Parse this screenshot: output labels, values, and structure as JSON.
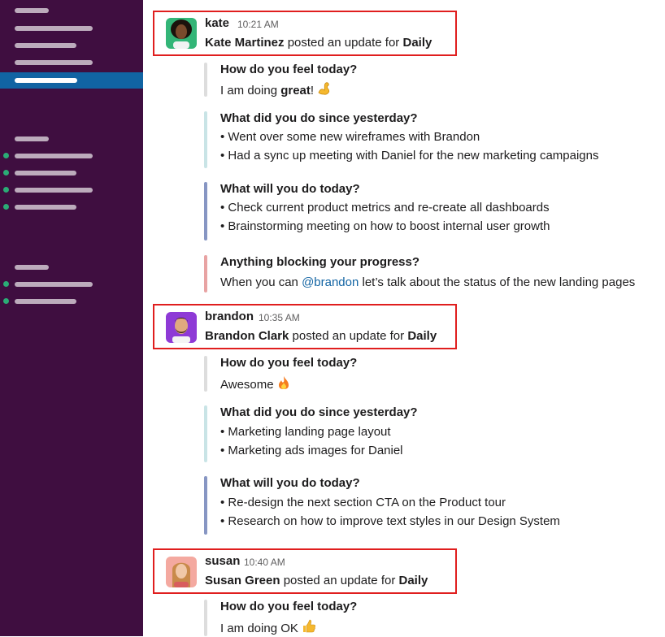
{
  "sidebar": {
    "items": [
      {
        "kind": "bar"
      },
      {
        "kind": "bar"
      },
      {
        "kind": "bar"
      },
      {
        "kind": "active"
      },
      {
        "kind": "header"
      },
      {
        "kind": "dm"
      },
      {
        "kind": "dm"
      },
      {
        "kind": "dm"
      },
      {
        "kind": "dm"
      },
      {
        "kind": "header"
      },
      {
        "kind": "dm"
      },
      {
        "kind": "dm"
      }
    ]
  },
  "colors": {
    "sidebar_bg": "#3f0e40",
    "active_row": "#1164a3",
    "presence": "#2bac76",
    "highlight_box": "#e01e1e",
    "bar_q1": "#dddddd",
    "bar_q2": "#c9e4e6",
    "bar_q3": "#8796c3",
    "bar_q4": "#e8a3a3"
  },
  "messages": [
    {
      "username": "kate",
      "time": "10:21 AM",
      "fullname": "Kate Martinez",
      "posted_text": " posted an update for ",
      "channel": "Daily",
      "avatar_icon": "kate-avatar-icon",
      "q1": {
        "question": "How do you feel today?",
        "answer_pre": "I am doing ",
        "answer_bold": "great",
        "answer_post": "!",
        "emoji": "flexed-biceps-icon"
      },
      "q2": {
        "question": "What did you do since yesterday?",
        "lines": [
          "• Went over some new wireframes with Brandon",
          "• Had a sync up meeting with Daniel for the new marketing campaigns"
        ]
      },
      "q3": {
        "question": "What will you do today?",
        "lines": [
          "• Check current product metrics and re-create all dashboards",
          "• Brainstorming meeting on how to boost internal user growth"
        ]
      },
      "q4": {
        "question": "Anything blocking your progress?",
        "answer_pre": "When you can ",
        "mention": "@brandon",
        "answer_post": " let’s talk about the status of the new landing pages"
      }
    },
    {
      "username": "brandon",
      "time": "10:35 AM",
      "fullname": "Brandon Clark",
      "posted_text": " posted an update for ",
      "channel": "Daily",
      "avatar_icon": "brandon-avatar-icon",
      "q1": {
        "question": "How do you feel today?",
        "answer": "Awesome",
        "emoji": "fire-icon"
      },
      "q2": {
        "question": "What did you do since yesterday?",
        "lines": [
          "• Marketing landing page layout",
          "• Marketing ads images for Daniel"
        ]
      },
      "q3": {
        "question": "What will you do today?",
        "lines": [
          "• Re-design the next section CTA on the Product tour",
          "• Research on how to improve text styles in our Design System"
        ]
      }
    },
    {
      "username": "susan",
      "time": "10:40 AM",
      "fullname": "Susan Green",
      "posted_text": " posted an update for ",
      "channel": "Daily",
      "avatar_icon": "susan-avatar-icon",
      "q1": {
        "question": "How do you feel today?",
        "answer": "I am doing OK",
        "emoji": "thumbs-up-icon"
      }
    }
  ]
}
